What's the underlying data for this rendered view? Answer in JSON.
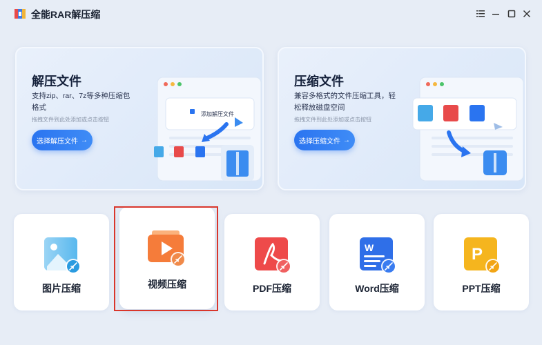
{
  "app": {
    "title": "全能RAR解压缩"
  },
  "window_controls": [
    "menu-icon",
    "minimize-icon",
    "maximize-icon",
    "close-icon"
  ],
  "extract_card": {
    "title": "解压文件",
    "desc": "支持zip、rar、7z等多种压缩包格式",
    "hint": "拖拽文件到此处添加或点击按钮",
    "button_label": "选择解压文件",
    "drop_label": "添加解压文件"
  },
  "compress_card": {
    "title": "压缩文件",
    "desc": "兼容多格式的文件压缩工具，轻松释放磁盘空间",
    "hint": "拖拽文件到此处添加或点击按钮",
    "button_label": "选择压缩文件"
  },
  "tools": [
    {
      "label": "图片压缩",
      "icon": "image-compress-icon"
    },
    {
      "label": "视频压缩",
      "icon": "video-compress-icon"
    },
    {
      "label": "PDF压缩",
      "icon": "pdf-compress-icon"
    },
    {
      "label": "Word压缩",
      "icon": "word-compress-icon"
    },
    {
      "label": "PPT压缩",
      "icon": "ppt-compress-icon"
    }
  ],
  "colors": {
    "accent": "#2a74f0",
    "selection": "#d9362b",
    "background": "#e7edf6"
  }
}
